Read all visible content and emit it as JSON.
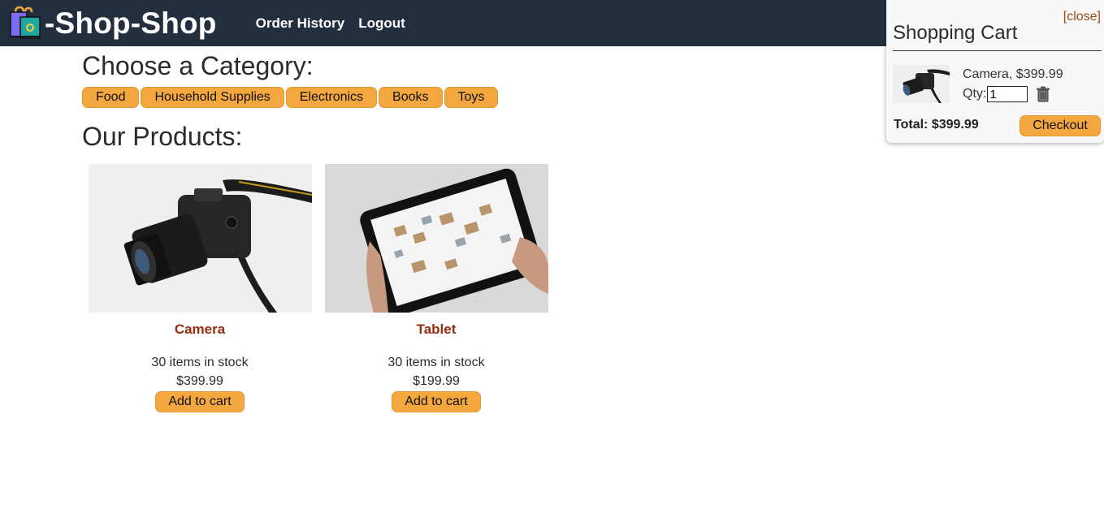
{
  "header": {
    "logo_icon": "shopping-bag-icon",
    "brand": "-Shop-Shop",
    "nav": [
      "Order History",
      "Logout"
    ]
  },
  "categories": {
    "title": "Choose a Category:",
    "items": [
      "Food",
      "Household Supplies",
      "Electronics",
      "Books",
      "Toys"
    ]
  },
  "products": {
    "title": "Our Products:",
    "items": [
      {
        "name": "Camera",
        "stock": "30 items in stock",
        "price": "$399.99",
        "button": "Add to cart",
        "image": "camera-photo"
      },
      {
        "name": "Tablet",
        "stock": "30 items in stock",
        "price": "$199.99",
        "button": "Add to cart",
        "image": "tablet-photo"
      }
    ]
  },
  "cart": {
    "close": "[close]",
    "title": "Shopping Cart",
    "item": {
      "label": "Camera, $399.99",
      "qty_label": "Qty:",
      "qty": "1",
      "image": "camera-photo"
    },
    "total": "Total: $399.99",
    "checkout": "Checkout",
    "remove_icon": "trash-icon"
  },
  "colors": {
    "header_bg": "#232f3e",
    "button_bg": "#f4a73f",
    "product_name": "#9a2a0e"
  }
}
